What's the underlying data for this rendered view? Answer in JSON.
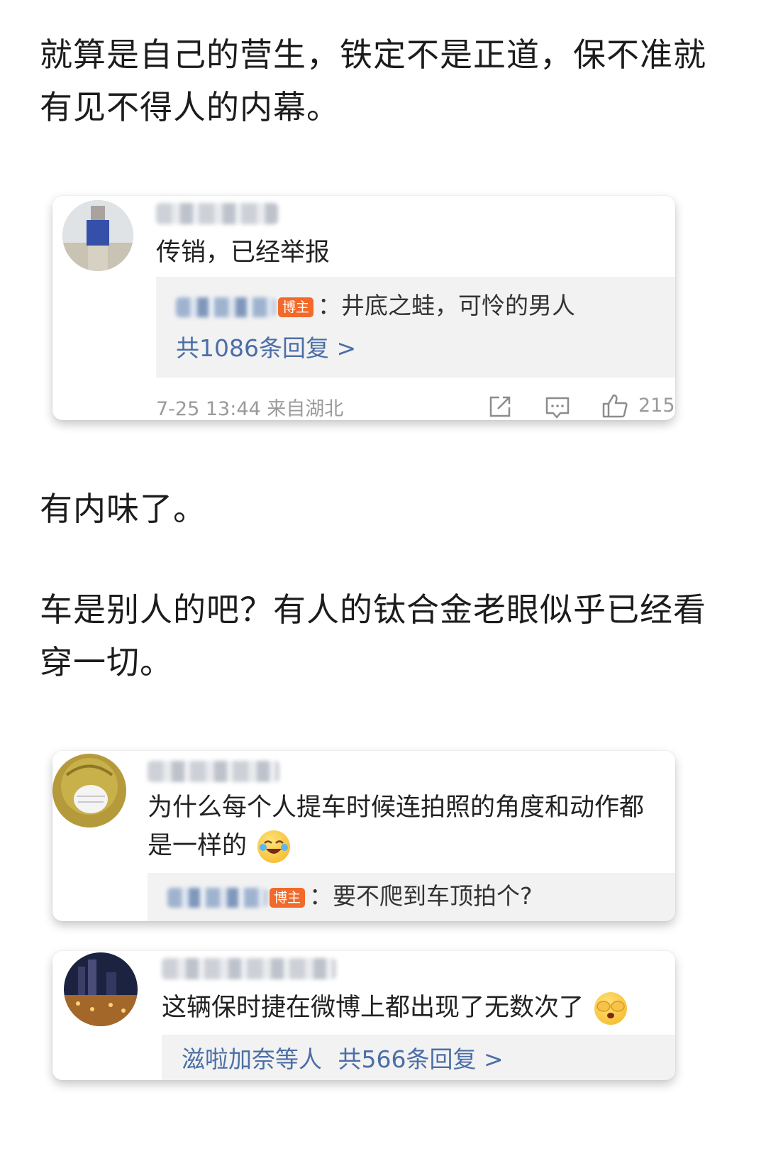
{
  "paragraphs": {
    "p1": "就算是自己的营生，铁定不是正道，保不准就有见不得人的内幕。",
    "p2": "有内味了。",
    "p3": "车是别人的吧？有人的钛合金老眼似乎已经看穿一切。"
  },
  "cards": [
    {
      "comment": "传销，已经举报",
      "reply_badge": "博主",
      "reply_text": "：井底之蛙，可怜的男人",
      "reply_count": "共1086条回复 >",
      "timestamp": "7-25 13:44",
      "location": "来自湖北",
      "likes": "215"
    },
    {
      "comment_line1": "为什么每个人提车时候连拍照的角度和动作都",
      "comment_line2": "是一样的",
      "emoji": "laugh-cry-emoji",
      "reply_badge": "博主",
      "reply_text": "：要不爬到车顶拍个?"
    },
    {
      "comment": "这辆保时捷在微博上都出现了无数次了",
      "emoji": "cover-eyes-emoji",
      "reply_names": "滋啦加奈等人",
      "reply_count": "共566条回复 >"
    }
  ],
  "colors": {
    "link": "#4b6ea6",
    "badge": "#f26a2a",
    "reply_bg": "#f2f2f2"
  }
}
